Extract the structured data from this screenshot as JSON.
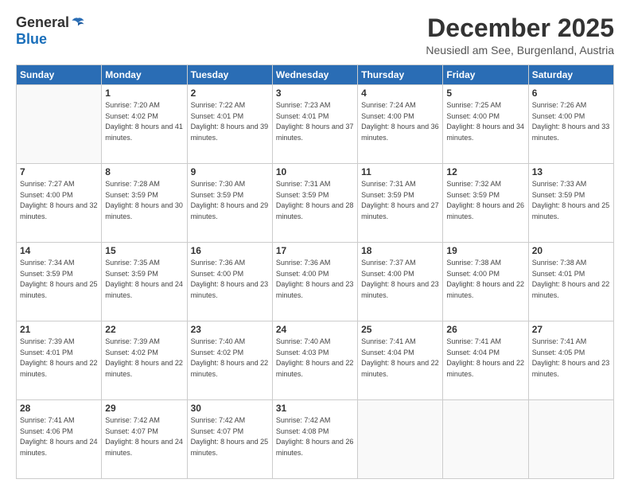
{
  "header": {
    "logo_general": "General",
    "logo_blue": "Blue",
    "month_title": "December 2025",
    "location": "Neusiedl am See, Burgenland, Austria"
  },
  "days_of_week": [
    "Sunday",
    "Monday",
    "Tuesday",
    "Wednesday",
    "Thursday",
    "Friday",
    "Saturday"
  ],
  "weeks": [
    [
      {
        "day": "",
        "sunrise": "",
        "sunset": "",
        "daylight": ""
      },
      {
        "day": "1",
        "sunrise": "Sunrise: 7:20 AM",
        "sunset": "Sunset: 4:02 PM",
        "daylight": "Daylight: 8 hours and 41 minutes."
      },
      {
        "day": "2",
        "sunrise": "Sunrise: 7:22 AM",
        "sunset": "Sunset: 4:01 PM",
        "daylight": "Daylight: 8 hours and 39 minutes."
      },
      {
        "day": "3",
        "sunrise": "Sunrise: 7:23 AM",
        "sunset": "Sunset: 4:01 PM",
        "daylight": "Daylight: 8 hours and 37 minutes."
      },
      {
        "day": "4",
        "sunrise": "Sunrise: 7:24 AM",
        "sunset": "Sunset: 4:00 PM",
        "daylight": "Daylight: 8 hours and 36 minutes."
      },
      {
        "day": "5",
        "sunrise": "Sunrise: 7:25 AM",
        "sunset": "Sunset: 4:00 PM",
        "daylight": "Daylight: 8 hours and 34 minutes."
      },
      {
        "day": "6",
        "sunrise": "Sunrise: 7:26 AM",
        "sunset": "Sunset: 4:00 PM",
        "daylight": "Daylight: 8 hours and 33 minutes."
      }
    ],
    [
      {
        "day": "7",
        "sunrise": "Sunrise: 7:27 AM",
        "sunset": "Sunset: 4:00 PM",
        "daylight": "Daylight: 8 hours and 32 minutes."
      },
      {
        "day": "8",
        "sunrise": "Sunrise: 7:28 AM",
        "sunset": "Sunset: 3:59 PM",
        "daylight": "Daylight: 8 hours and 30 minutes."
      },
      {
        "day": "9",
        "sunrise": "Sunrise: 7:30 AM",
        "sunset": "Sunset: 3:59 PM",
        "daylight": "Daylight: 8 hours and 29 minutes."
      },
      {
        "day": "10",
        "sunrise": "Sunrise: 7:31 AM",
        "sunset": "Sunset: 3:59 PM",
        "daylight": "Daylight: 8 hours and 28 minutes."
      },
      {
        "day": "11",
        "sunrise": "Sunrise: 7:31 AM",
        "sunset": "Sunset: 3:59 PM",
        "daylight": "Daylight: 8 hours and 27 minutes."
      },
      {
        "day": "12",
        "sunrise": "Sunrise: 7:32 AM",
        "sunset": "Sunset: 3:59 PM",
        "daylight": "Daylight: 8 hours and 26 minutes."
      },
      {
        "day": "13",
        "sunrise": "Sunrise: 7:33 AM",
        "sunset": "Sunset: 3:59 PM",
        "daylight": "Daylight: 8 hours and 25 minutes."
      }
    ],
    [
      {
        "day": "14",
        "sunrise": "Sunrise: 7:34 AM",
        "sunset": "Sunset: 3:59 PM",
        "daylight": "Daylight: 8 hours and 25 minutes."
      },
      {
        "day": "15",
        "sunrise": "Sunrise: 7:35 AM",
        "sunset": "Sunset: 3:59 PM",
        "daylight": "Daylight: 8 hours and 24 minutes."
      },
      {
        "day": "16",
        "sunrise": "Sunrise: 7:36 AM",
        "sunset": "Sunset: 4:00 PM",
        "daylight": "Daylight: 8 hours and 23 minutes."
      },
      {
        "day": "17",
        "sunrise": "Sunrise: 7:36 AM",
        "sunset": "Sunset: 4:00 PM",
        "daylight": "Daylight: 8 hours and 23 minutes."
      },
      {
        "day": "18",
        "sunrise": "Sunrise: 7:37 AM",
        "sunset": "Sunset: 4:00 PM",
        "daylight": "Daylight: 8 hours and 23 minutes."
      },
      {
        "day": "19",
        "sunrise": "Sunrise: 7:38 AM",
        "sunset": "Sunset: 4:00 PM",
        "daylight": "Daylight: 8 hours and 22 minutes."
      },
      {
        "day": "20",
        "sunrise": "Sunrise: 7:38 AM",
        "sunset": "Sunset: 4:01 PM",
        "daylight": "Daylight: 8 hours and 22 minutes."
      }
    ],
    [
      {
        "day": "21",
        "sunrise": "Sunrise: 7:39 AM",
        "sunset": "Sunset: 4:01 PM",
        "daylight": "Daylight: 8 hours and 22 minutes."
      },
      {
        "day": "22",
        "sunrise": "Sunrise: 7:39 AM",
        "sunset": "Sunset: 4:02 PM",
        "daylight": "Daylight: 8 hours and 22 minutes."
      },
      {
        "day": "23",
        "sunrise": "Sunrise: 7:40 AM",
        "sunset": "Sunset: 4:02 PM",
        "daylight": "Daylight: 8 hours and 22 minutes."
      },
      {
        "day": "24",
        "sunrise": "Sunrise: 7:40 AM",
        "sunset": "Sunset: 4:03 PM",
        "daylight": "Daylight: 8 hours and 22 minutes."
      },
      {
        "day": "25",
        "sunrise": "Sunrise: 7:41 AM",
        "sunset": "Sunset: 4:04 PM",
        "daylight": "Daylight: 8 hours and 22 minutes."
      },
      {
        "day": "26",
        "sunrise": "Sunrise: 7:41 AM",
        "sunset": "Sunset: 4:04 PM",
        "daylight": "Daylight: 8 hours and 22 minutes."
      },
      {
        "day": "27",
        "sunrise": "Sunrise: 7:41 AM",
        "sunset": "Sunset: 4:05 PM",
        "daylight": "Daylight: 8 hours and 23 minutes."
      }
    ],
    [
      {
        "day": "28",
        "sunrise": "Sunrise: 7:41 AM",
        "sunset": "Sunset: 4:06 PM",
        "daylight": "Daylight: 8 hours and 24 minutes."
      },
      {
        "day": "29",
        "sunrise": "Sunrise: 7:42 AM",
        "sunset": "Sunset: 4:07 PM",
        "daylight": "Daylight: 8 hours and 24 minutes."
      },
      {
        "day": "30",
        "sunrise": "Sunrise: 7:42 AM",
        "sunset": "Sunset: 4:07 PM",
        "daylight": "Daylight: 8 hours and 25 minutes."
      },
      {
        "day": "31",
        "sunrise": "Sunrise: 7:42 AM",
        "sunset": "Sunset: 4:08 PM",
        "daylight": "Daylight: 8 hours and 26 minutes."
      },
      {
        "day": "",
        "sunrise": "",
        "sunset": "",
        "daylight": ""
      },
      {
        "day": "",
        "sunrise": "",
        "sunset": "",
        "daylight": ""
      },
      {
        "day": "",
        "sunrise": "",
        "sunset": "",
        "daylight": ""
      }
    ]
  ]
}
